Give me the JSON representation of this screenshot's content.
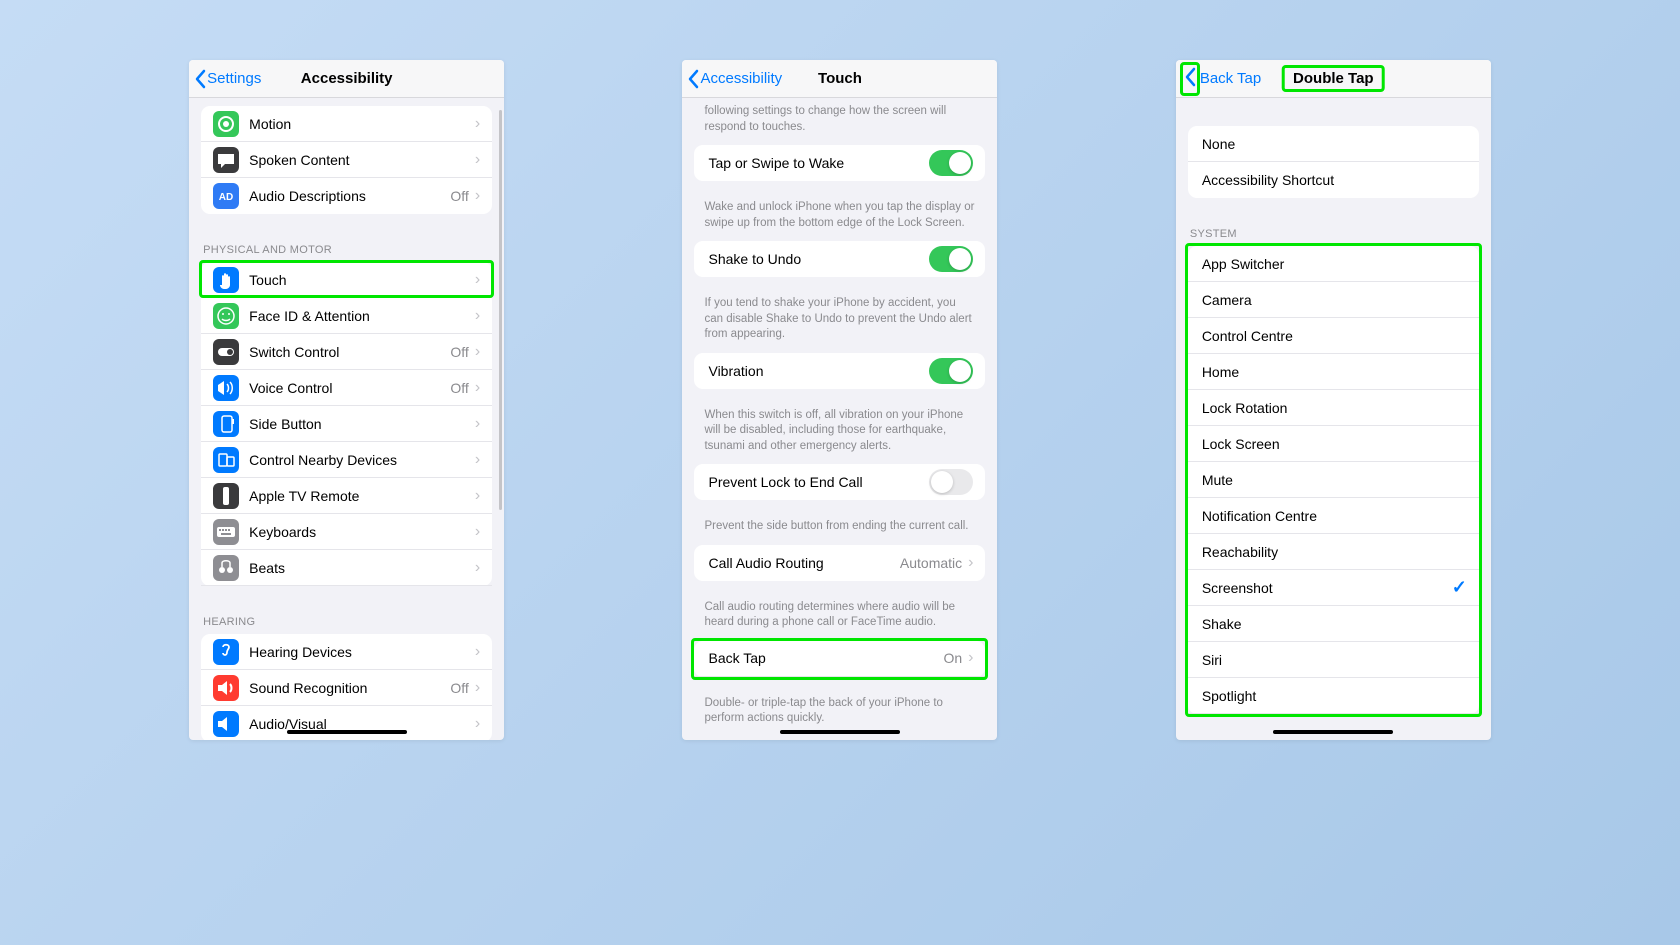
{
  "screen1": {
    "back": "Settings",
    "title": "Accessibility",
    "vision_rows": [
      {
        "label": "Motion",
        "icon_bg": "#34c759",
        "icon_svg": "motion"
      },
      {
        "label": "Spoken Content",
        "icon_bg": "#3a3a3c",
        "icon_svg": "bubble"
      },
      {
        "label": "Audio Descriptions",
        "icon_bg": "#2f7bf5",
        "icon_svg": "audiodesc",
        "value": "Off"
      }
    ],
    "physical_header": "PHYSICAL AND MOTOR",
    "physical_rows": [
      {
        "label": "Touch",
        "icon_bg": "#007aff",
        "icon_svg": "hand"
      },
      {
        "label": "Face ID & Attention",
        "icon_bg": "#34c759",
        "icon_svg": "face"
      },
      {
        "label": "Switch Control",
        "icon_bg": "#3a3a3c",
        "icon_svg": "switch",
        "value": "Off"
      },
      {
        "label": "Voice Control",
        "icon_bg": "#007aff",
        "icon_svg": "voice",
        "value": "Off"
      },
      {
        "label": "Side Button",
        "icon_bg": "#007aff",
        "icon_svg": "side"
      },
      {
        "label": "Control Nearby Devices",
        "icon_bg": "#007aff",
        "icon_svg": "nearby"
      },
      {
        "label": "Apple TV Remote",
        "icon_bg": "#3a3a3c",
        "icon_svg": "remote"
      },
      {
        "label": "Keyboards",
        "icon_bg": "#8e8e93",
        "icon_svg": "keyboard"
      },
      {
        "label": "Beats",
        "icon_bg": "#8e8e93",
        "icon_svg": "beats"
      }
    ],
    "hearing_header": "HEARING",
    "hearing_rows": [
      {
        "label": "Hearing Devices",
        "icon_bg": "#007aff",
        "icon_svg": "ear"
      },
      {
        "label": "Sound Recognition",
        "icon_bg": "#ff3b30",
        "icon_svg": "sound",
        "value": "Off"
      },
      {
        "label": "Audio/Visual",
        "icon_bg": "#007aff",
        "icon_svg": "av"
      }
    ]
  },
  "screen2": {
    "back": "Accessibility",
    "title": "Touch",
    "intro": "following settings to change how the screen will respond to touches.",
    "rows": [
      {
        "label": "Tap or Swipe to Wake",
        "switch": "on",
        "footer": "Wake and unlock iPhone when you tap the display or swipe up from the bottom edge of the Lock Screen."
      },
      {
        "label": "Shake to Undo",
        "switch": "on",
        "footer": "If you tend to shake your iPhone by accident, you can disable Shake to Undo to prevent the Undo alert from appearing."
      },
      {
        "label": "Vibration",
        "switch": "on",
        "footer": "When this switch is off, all vibration on your iPhone will be disabled, including those for earthquake, tsunami and other emergency alerts."
      },
      {
        "label": "Prevent Lock to End Call",
        "switch": "off",
        "footer": "Prevent the side button from ending the current call."
      },
      {
        "label": "Call Audio Routing",
        "value": "Automatic",
        "chev": true,
        "footer": "Call audio routing determines where audio will be heard during a phone call or FaceTime audio."
      },
      {
        "label": "Back Tap",
        "value": "On",
        "chev": true,
        "footer": "Double- or triple-tap the back of your iPhone to perform actions quickly.",
        "highlight": true
      }
    ]
  },
  "screen3": {
    "back": "Back Tap",
    "title": "Double Tap",
    "top_rows": [
      "None",
      "Accessibility Shortcut"
    ],
    "system_header": "SYSTEM",
    "system_rows": [
      {
        "label": "App Switcher"
      },
      {
        "label": "Camera"
      },
      {
        "label": "Control Centre"
      },
      {
        "label": "Home"
      },
      {
        "label": "Lock Rotation"
      },
      {
        "label": "Lock Screen"
      },
      {
        "label": "Mute"
      },
      {
        "label": "Notification Centre"
      },
      {
        "label": "Reachability"
      },
      {
        "label": "Screenshot",
        "checked": true
      },
      {
        "label": "Shake"
      },
      {
        "label": "Siri"
      },
      {
        "label": "Spotlight"
      }
    ]
  }
}
